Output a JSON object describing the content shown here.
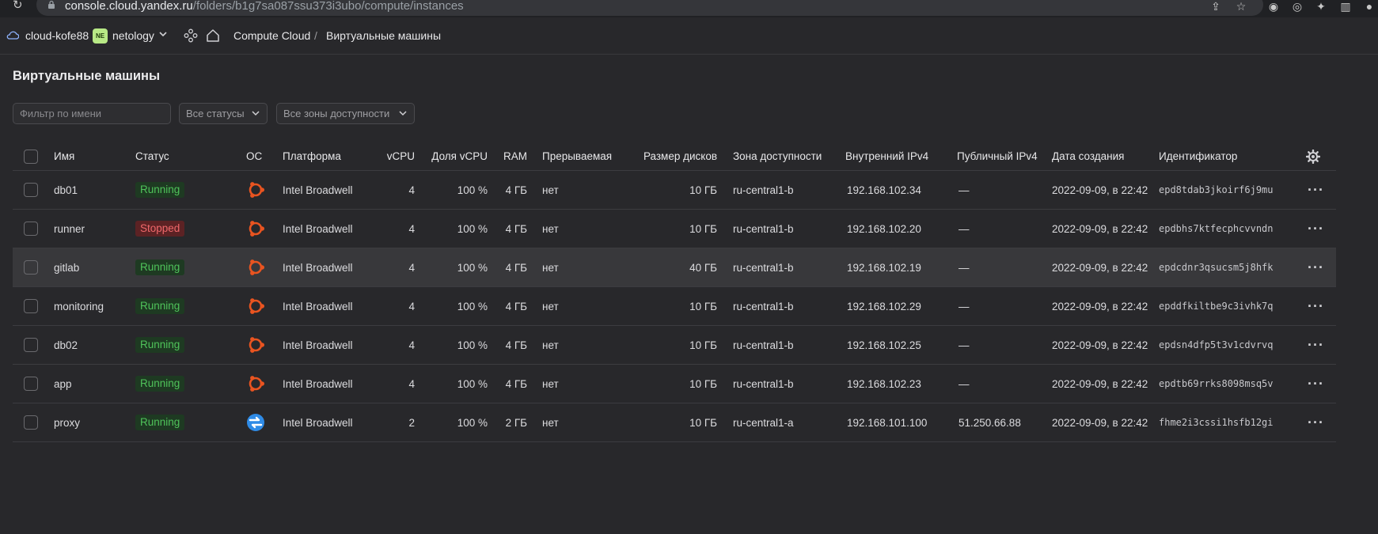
{
  "browser": {
    "url_host": "console.cloud.yandex.ru",
    "url_path": "/folders/b1g7sa087ssu373i3ubo/compute/instances"
  },
  "header": {
    "cloud_name": "cloud-kofe88",
    "folder_badge": "NE",
    "folder_name": "netology",
    "breadcrumb_service": "Compute Cloud",
    "breadcrumb_sep": "/",
    "breadcrumb_page": "Виртуальные машины"
  },
  "page": {
    "title": "Виртуальные машины",
    "filter_placeholder": "Фильтр по имени",
    "status_select": "Все статусы",
    "zone_select": "Все зоны доступности"
  },
  "table": {
    "columns": {
      "name": "Имя",
      "status": "Статус",
      "os": "ОС",
      "platform": "Платформа",
      "vcpu": "vCPU",
      "vcpu_share": "Доля vCPU",
      "ram": "RAM",
      "preemptible": "Прерываемая",
      "disk_size": "Размер дисков",
      "zone": "Зона доступности",
      "internal_ip": "Внутренний IPv4",
      "public_ip": "Публичный IPv4",
      "created": "Дата создания",
      "id": "Идентификатор"
    },
    "rows": [
      {
        "name": "db01",
        "status": "Running",
        "status_kind": "running",
        "os_icon": "ubuntu-icon",
        "platform": "Intel Broadwell",
        "vcpu": "4",
        "vcpu_share": "100 %",
        "ram": "4 ГБ",
        "preemptible": "нет",
        "disk_size": "10 ГБ",
        "zone": "ru-central1-b",
        "internal_ip": "192.168.102.34",
        "public_ip": "—",
        "created": "2022-09-09, в 22:42",
        "id": "epd8tdab3jkoirf6j9mu"
      },
      {
        "name": "runner",
        "status": "Stopped",
        "status_kind": "stopped",
        "os_icon": "ubuntu-icon",
        "platform": "Intel Broadwell",
        "vcpu": "4",
        "vcpu_share": "100 %",
        "ram": "4 ГБ",
        "preemptible": "нет",
        "disk_size": "10 ГБ",
        "zone": "ru-central1-b",
        "internal_ip": "192.168.102.20",
        "public_ip": "—",
        "created": "2022-09-09, в 22:42",
        "id": "epdbhs7ktfecphcvvndn"
      },
      {
        "name": "gitlab",
        "status": "Running",
        "status_kind": "running",
        "os_icon": "ubuntu-icon",
        "platform": "Intel Broadwell",
        "vcpu": "4",
        "vcpu_share": "100 %",
        "ram": "4 ГБ",
        "preemptible": "нет",
        "disk_size": "40 ГБ",
        "zone": "ru-central1-b",
        "internal_ip": "192.168.102.19",
        "public_ip": "—",
        "created": "2022-09-09, в 22:42",
        "id": "epdcdnr3qsucsm5j8hfk",
        "highlighted": true
      },
      {
        "name": "monitoring",
        "status": "Running",
        "status_kind": "running",
        "os_icon": "ubuntu-icon",
        "platform": "Intel Broadwell",
        "vcpu": "4",
        "vcpu_share": "100 %",
        "ram": "4 ГБ",
        "preemptible": "нет",
        "disk_size": "10 ГБ",
        "zone": "ru-central1-b",
        "internal_ip": "192.168.102.29",
        "public_ip": "—",
        "created": "2022-09-09, в 22:42",
        "id": "epddfkiltbe9c3ivhk7q"
      },
      {
        "name": "db02",
        "status": "Running",
        "status_kind": "running",
        "os_icon": "ubuntu-icon",
        "platform": "Intel Broadwell",
        "vcpu": "4",
        "vcpu_share": "100 %",
        "ram": "4 ГБ",
        "preemptible": "нет",
        "disk_size": "10 ГБ",
        "zone": "ru-central1-b",
        "internal_ip": "192.168.102.25",
        "public_ip": "—",
        "created": "2022-09-09, в 22:42",
        "id": "epdsn4dfp5t3v1cdvrvq"
      },
      {
        "name": "app",
        "status": "Running",
        "status_kind": "running",
        "os_icon": "ubuntu-icon",
        "platform": "Intel Broadwell",
        "vcpu": "4",
        "vcpu_share": "100 %",
        "ram": "4 ГБ",
        "preemptible": "нет",
        "disk_size": "10 ГБ",
        "zone": "ru-central1-b",
        "internal_ip": "192.168.102.23",
        "public_ip": "—",
        "created": "2022-09-09, в 22:42",
        "id": "epdtb69rrks8098msq5v"
      },
      {
        "name": "proxy",
        "status": "Running",
        "status_kind": "running",
        "os_icon": "nat-instance-icon",
        "platform": "Intel Broadwell",
        "vcpu": "2",
        "vcpu_share": "100 %",
        "ram": "2 ГБ",
        "preemptible": "нет",
        "disk_size": "10 ГБ",
        "zone": "ru-central1-a",
        "internal_ip": "192.168.101.100",
        "public_ip": "51.250.66.88",
        "created": "2022-09-09, в 22:42",
        "id": "fhme2i3cssi1hsfb12gi"
      }
    ]
  },
  "colors": {
    "background": "#28282b",
    "running_text": "#4fc35a",
    "running_bg": "#1e3a22",
    "stopped_text": "#f0686b",
    "stopped_bg": "#5c2224",
    "ubuntu_orange": "#e95420",
    "nat_blue": "#2f8be6"
  }
}
